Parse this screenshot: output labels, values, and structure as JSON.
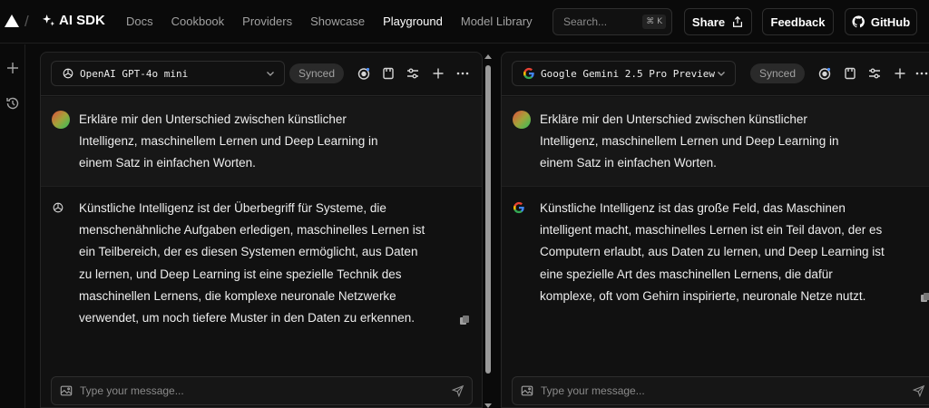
{
  "nav": {
    "brand": "AI SDK",
    "links": [
      "Docs",
      "Cookbook",
      "Providers",
      "Showcase",
      "Playground",
      "Model Library"
    ],
    "active_link": "Playground",
    "search_placeholder": "Search...",
    "search_shortcut": "⌘ K",
    "share_label": "Share",
    "feedback_label": "Feedback",
    "github_label": "GitHub"
  },
  "panels": [
    {
      "model_name": "OpenAI GPT-4o mini",
      "sync_status": "Synced",
      "user_message": [
        "Erkläre mir den Unterschied zwischen künstlicher",
        "Intelligenz, maschinellem Lernen und Deep Learning in",
        "einem Satz in einfachen Worten."
      ],
      "assistant_message": [
        "Künstliche Intelligenz ist der Überbegriff für Systeme, die",
        "menschenähnliche Aufgaben erledigen, maschinelles Lernen ist",
        "ein Teilbereich, der es diesen Systemen ermöglicht, aus Daten",
        "zu lernen, und Deep Learning ist eine spezielle Technik des",
        "maschinellen Lernens, die komplexe neuronale Netzwerke",
        "verwendet, um noch tiefere Muster in den Daten zu erkennen."
      ],
      "input_placeholder": "Type your message..."
    },
    {
      "model_name": "Google Gemini 2.5 Pro Preview",
      "sync_status": "Synced",
      "user_message": [
        "Erkläre mir den Unterschied zwischen künstlicher",
        "Intelligenz, maschinellem Lernen und Deep Learning in",
        "einem Satz in einfachen Worten."
      ],
      "assistant_message": [
        "Künstliche Intelligenz ist das große Feld, das Maschinen",
        "intelligent macht, maschinelles Lernen ist ein Teil davon, der es",
        "Computern erlaubt, aus Daten zu lernen, und Deep Learning ist",
        "eine spezielle Art des maschinellen Lernens, die dafür",
        "komplexe, oft vom Gehirn inspirierte, neuronale Netze nutzt."
      ],
      "input_placeholder": "Type your message..."
    }
  ],
  "colors": {
    "background": "#0a0a0a",
    "panel": "#111111",
    "user_message_bg": "#171717",
    "text": "#ededed",
    "muted": "#a1a1a1"
  },
  "icons": {
    "logo": "triangle-logo-icon",
    "brand": "sparkle-icon",
    "share": "share-icon",
    "github": "github-icon",
    "rail": [
      "plus-icon",
      "history-icon"
    ],
    "panel_tools": [
      "thinking-icon",
      "notebook-icon",
      "sliders-icon",
      "plus-icon",
      "more-icon"
    ],
    "input": [
      "image-icon",
      "send-icon"
    ]
  }
}
